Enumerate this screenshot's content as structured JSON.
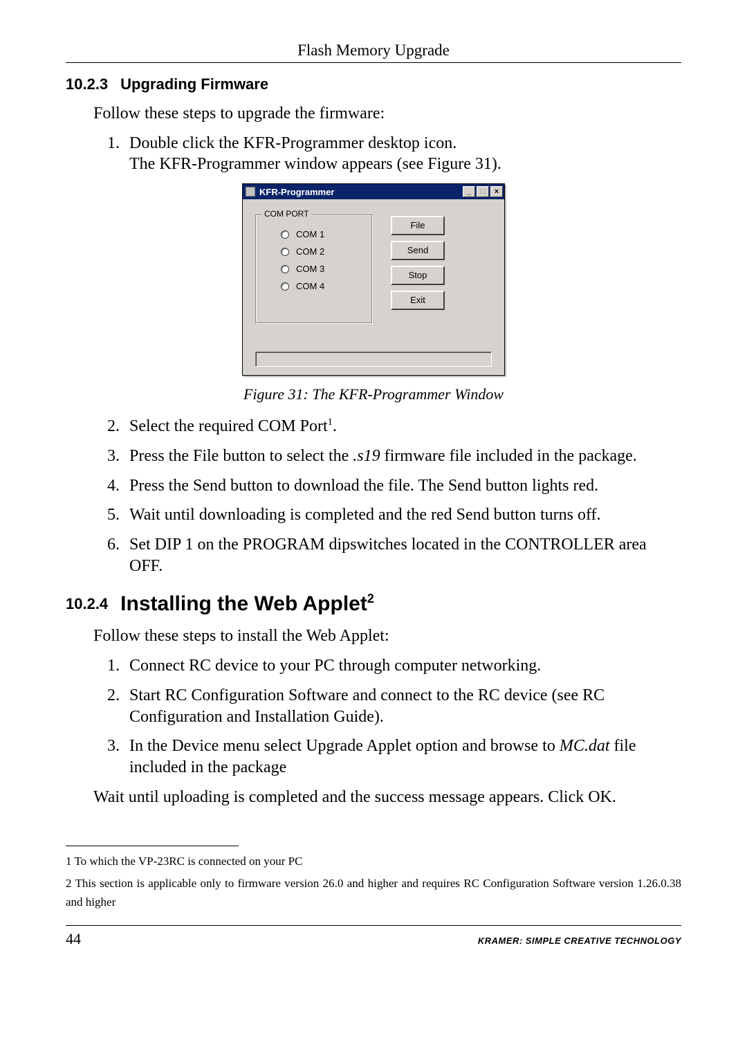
{
  "header": {
    "running_title": "Flash Memory Upgrade"
  },
  "section_10_2_3": {
    "number": "10.2.3",
    "title": "Upgrading Firmware",
    "intro": "Follow these steps to upgrade the firmware:",
    "steps_a": {
      "1_line1": "Double click the KFR-Programmer desktop icon.",
      "1_line2": "The KFR-Programmer window appears (see Figure 31)."
    },
    "steps_b": {
      "2_pre": "Select the required COM Port",
      "2_sup": "1",
      "2_post": ".",
      "3_pre": "Press the File button to select the ",
      "3_em": ".s19",
      "3_post": " firmware file included in the package.",
      "4": "Press the Send button to download the file. The Send button lights red.",
      "5": "Wait until downloading is completed and the red Send button turns off.",
      "6": "Set DIP 1 on the PROGRAM dipswitches located in the CONTROLLER area OFF."
    }
  },
  "figure31": {
    "caption": "Figure 31: The KFR-Programmer Window",
    "window_title": "KFR-Programmer",
    "groupbox_label": "COM PORT",
    "radios": {
      "1": "COM 1",
      "2": "COM 2",
      "3": "COM 3",
      "4": "COM 4"
    },
    "buttons": {
      "file": "File",
      "send": "Send",
      "stop": "Stop",
      "exit": "Exit"
    },
    "ctrl": {
      "min": "_",
      "max": "□",
      "close": "×"
    }
  },
  "section_10_2_4": {
    "number": "10.2.4",
    "title_pre": "Installing the Web Applet",
    "title_sup": "2",
    "intro": "Follow these steps to install the Web Applet:",
    "steps": {
      "1": "Connect RC device to your PC through computer networking.",
      "2": "Start RC Configuration Software and connect to the RC device (see RC Configuration and Installation Guide).",
      "3_pre": "In the Device menu select Upgrade Applet option and browse to ",
      "3_em": "MC.dat",
      "3_post": " file included in the package"
    },
    "closing": "Wait until uploading is completed and the success message appears. Click OK."
  },
  "footnotes": {
    "1": "1 To which the VP-23RC is connected on your PC",
    "2": "2 This section is applicable only to firmware version 26.0 and higher and requires RC Configuration Software version 1.26.0.38 and higher"
  },
  "footer": {
    "page": "44",
    "brand": "KRAMER:  SIMPLE CREATIVE TECHNOLOGY"
  }
}
